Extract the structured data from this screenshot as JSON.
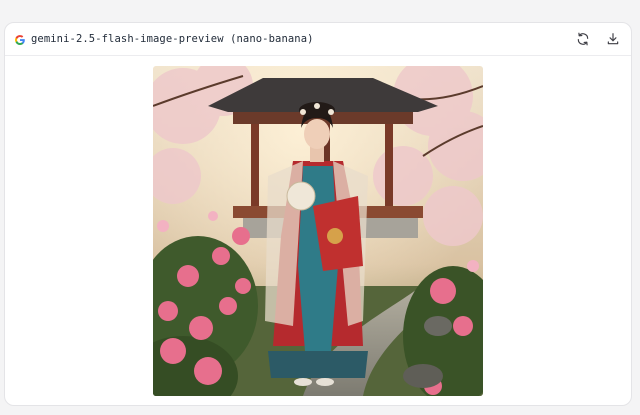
{
  "card": {
    "model_label": "gemini-2.5-flash-image-preview (nano-banana)",
    "brand_icon": "google-g-icon",
    "actions": {
      "regenerate_icon": "refresh-icon",
      "download_icon": "download-icon"
    }
  },
  "image": {
    "content": "woman-in-hanfu-garden-photo",
    "colors": {
      "sky": "#e9dcc8",
      "blossom": "#f0c6cc",
      "peony": "#e76f8d",
      "robe_red": "#b52a2e",
      "robe_teal": "#2f7b88",
      "pavilion": "#6b3a2a",
      "foliage": "#3f5a2c"
    }
  }
}
